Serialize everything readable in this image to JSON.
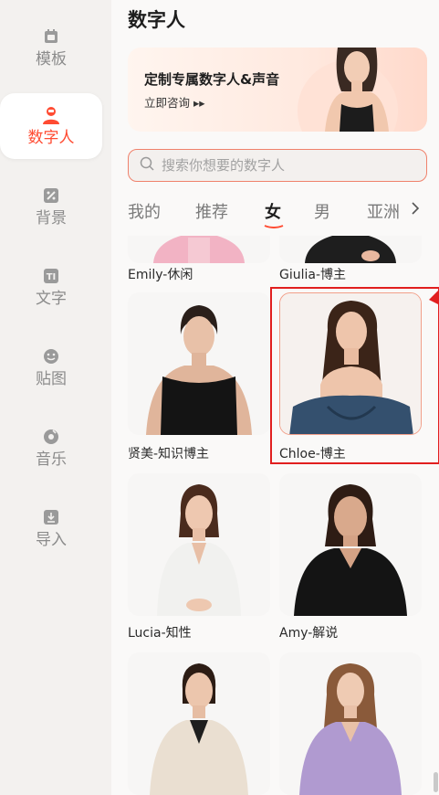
{
  "sidebar": {
    "items": [
      {
        "label": "模板",
        "icon": "template-icon",
        "active": false
      },
      {
        "label": "数字人",
        "icon": "digital-human-icon",
        "active": true
      },
      {
        "label": "背景",
        "icon": "background-icon",
        "active": false
      },
      {
        "label": "文字",
        "icon": "text-icon",
        "active": false
      },
      {
        "label": "贴图",
        "icon": "sticker-icon",
        "active": false
      },
      {
        "label": "音乐",
        "icon": "music-icon",
        "active": false
      },
      {
        "label": "导入",
        "icon": "import-icon",
        "active": false
      }
    ]
  },
  "page": {
    "title": "数字人"
  },
  "banner": {
    "title": "定制专属数字人&声音",
    "cta": "立即咨询 ▸▸"
  },
  "search": {
    "placeholder": "搜索你想要的数字人"
  },
  "tabs": {
    "items": [
      "我的",
      "推荐",
      "女",
      "男",
      "亚洲"
    ],
    "active": "女"
  },
  "cards": [
    {
      "name": "Emily-休闲"
    },
    {
      "name": "Giulia-博主"
    },
    {
      "name": "贤美-知识博主"
    },
    {
      "name": "Chloe-博主"
    },
    {
      "name": "Lucia-知性"
    },
    {
      "name": "Amy-解说"
    },
    {
      "name": ""
    },
    {
      "name": ""
    }
  ],
  "colors": {
    "accent": "#ff4b32",
    "highlight_border": "#e11f1f",
    "search_border": "#f0826c"
  }
}
